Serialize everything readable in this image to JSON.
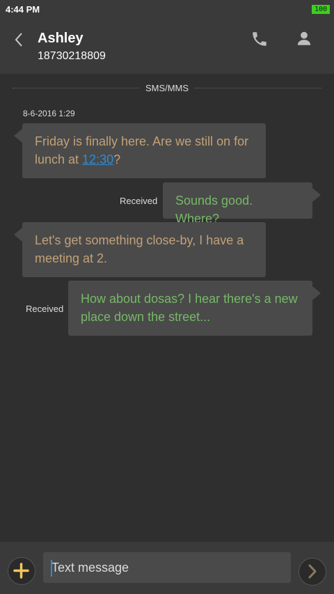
{
  "status_bar": {
    "time": "4:44 PM",
    "battery": "100"
  },
  "header": {
    "back_icon": "chevron-left-icon",
    "contact_name": "Ashley",
    "contact_number": "18730218809",
    "call_icon": "phone-icon",
    "profile_icon": "person-icon"
  },
  "thread": {
    "channel": "SMS/MMS",
    "timestamp": "8-6-2016 1:29",
    "messages": [
      {
        "direction": "in",
        "text_before": "Friday is finally here. Are we still on for lunch at ",
        "link": "12:30",
        "text_after": "?"
      },
      {
        "direction": "out",
        "status": "Received",
        "text": "Sounds good. Where?"
      },
      {
        "direction": "in",
        "text": "Let's get something close-by, I have a meeting at 2."
      },
      {
        "direction": "out",
        "status": "Received",
        "text": "How about dosas? I hear there's a new place down the street..."
      }
    ]
  },
  "composer": {
    "add_icon": "plus-icon",
    "placeholder": "Text message",
    "send_icon": "chevron-right-icon"
  },
  "colors": {
    "background": "#2f2f2f",
    "bar": "#3a3a3a",
    "bubble": "#4a4a4a",
    "incoming_text": "#c3a177",
    "outgoing_text": "#76b867",
    "link": "#2e8bd8",
    "battery": "#39d21a",
    "accent_plus": "#f5c65a"
  }
}
